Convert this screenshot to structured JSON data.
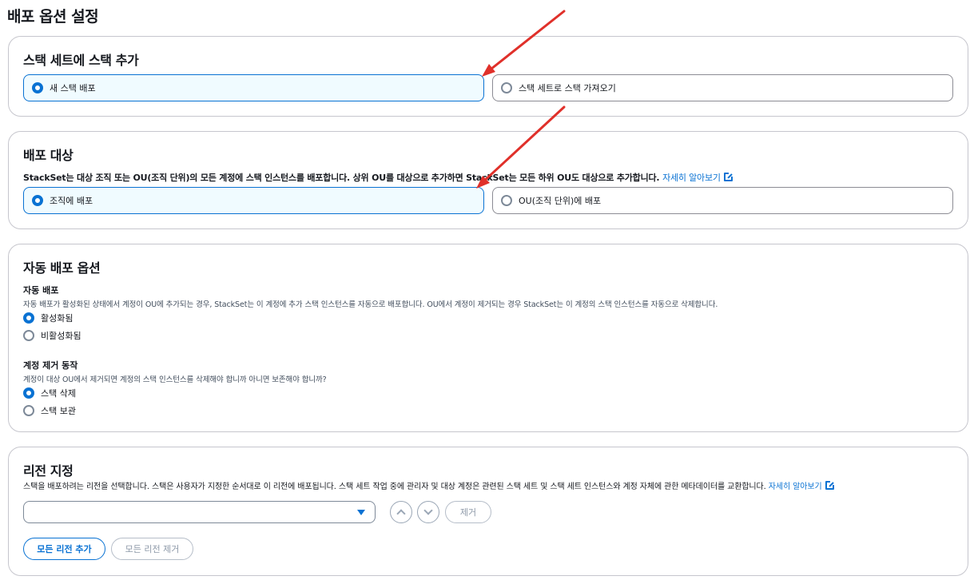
{
  "page": {
    "title": "배포 옵션 설정"
  },
  "add_stacks": {
    "title": "스택 세트에 스택 추가",
    "options": [
      {
        "label": "새 스택 배포",
        "selected": true
      },
      {
        "label": "스택 세트로 스택 가져오기",
        "selected": false
      }
    ]
  },
  "deploy_target": {
    "title": "배포 대상",
    "description": "StackSet는 대상 조직 또는 OU(조직 단위)의 모든 계정에 스택 인스턴스를 배포합니다. 상위 OU를 대상으로 추가하면 StackSet는 모든 하위 OU도 대상으로 추가합니다.",
    "learn_more": "자세히 알아보기",
    "options": [
      {
        "label": "조직에 배포",
        "selected": true
      },
      {
        "label": "OU(조직 단위)에 배포",
        "selected": false
      }
    ]
  },
  "auto_deploy": {
    "title": "자동 배포 옵션",
    "auto": {
      "heading": "자동 배포",
      "description": "자동 배포가 활성화된 상태에서 계정이 OU에 추가되는 경우, StackSet는 이 계정에 추가 스택 인스턴스를 자동으로 배포합니다. OU에서 계정이 제거되는 경우 StackSet는 이 계정의 스택 인스턴스를 자동으로 삭제합니다.",
      "options": [
        {
          "label": "활성화됨",
          "selected": true
        },
        {
          "label": "비활성화됨",
          "selected": false
        }
      ]
    },
    "removal": {
      "heading": "계정 제거 동작",
      "description": "계정이 대상 OU에서 제거되면 계정의 스택 인스턴스를 삭제해야 합니까 아니면 보존해야 합니까?",
      "options": [
        {
          "label": "스택 삭제",
          "selected": true
        },
        {
          "label": "스택 보관",
          "selected": false
        }
      ]
    }
  },
  "regions": {
    "title": "리전 지정",
    "description": "스택을 배포하려는 리전을 선택합니다. 스택은 사용자가 지정한 순서대로 이 리전에 배포됩니다. 스택 세트 작업 중에 관리자 및 대상 계정은 관련된 스택 세트 및 스택 세트 인스턴스와 계정 자체에 관한 메타데이터를 교환합니다.",
    "learn_more": "자세히 알아보기",
    "select_value": "",
    "remove_label": "제거",
    "add_all_label": "모든 리전 추가",
    "remove_all_label": "모든 리전 제거"
  },
  "colors": {
    "accent": "#0972d3",
    "annotation": "#e0302a",
    "border": "#c6c6cd"
  }
}
